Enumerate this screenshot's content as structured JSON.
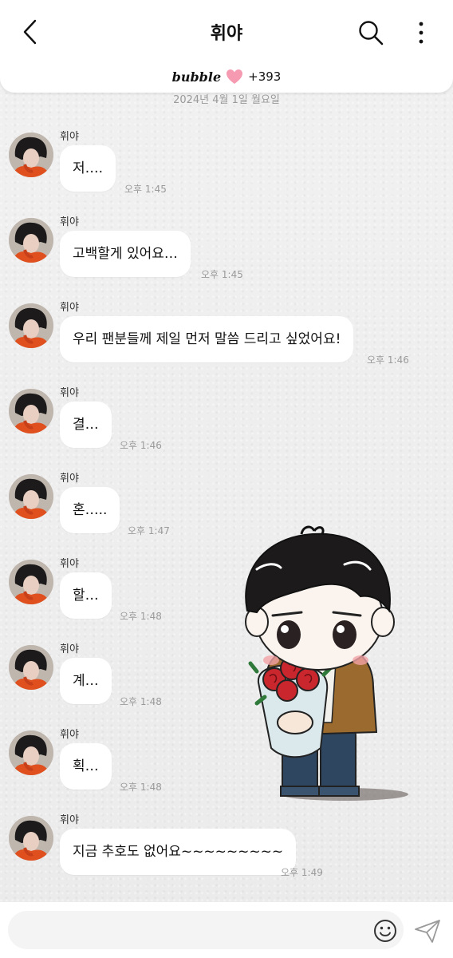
{
  "header": {
    "title": "휘야",
    "brand": "bubble",
    "plus_count": "+393"
  },
  "date_label": "2024년 4월 1일 월요일",
  "messages": [
    {
      "sender": "휘야",
      "text": "저….",
      "time": "오후 1:45"
    },
    {
      "sender": "휘야",
      "text": "고백할게 있어요…",
      "time": "오후 1:45"
    },
    {
      "sender": "휘야",
      "text": "우리 팬분들께 제일 먼저 말씀 드리고 싶었어요!",
      "time": "오후 1:46"
    },
    {
      "sender": "휘야",
      "text": "결…",
      "time": "오후 1:46"
    },
    {
      "sender": "휘야",
      "text": "혼…..",
      "time": "오후 1:47"
    },
    {
      "sender": "휘야",
      "text": "할…",
      "time": "오후 1:48"
    },
    {
      "sender": "휘야",
      "text": "계…",
      "time": "오후 1:48"
    },
    {
      "sender": "휘야",
      "text": "획…",
      "time": "오후 1:48"
    },
    {
      "sender": "휘야",
      "text": "지금 추호도 없어요~~~~~~~~~",
      "time": "오후 1:49"
    }
  ],
  "input": {
    "placeholder": ""
  },
  "icons": {
    "back": "chevron-left-icon",
    "search": "search-icon",
    "more": "more-vertical-icon",
    "heart": "heart-icon",
    "emoji": "smiley-icon",
    "send": "send-icon"
  },
  "colors": {
    "heart": "#f59ab0",
    "bubble_bg": "#ffffff",
    "time_text": "#9a9a9a"
  }
}
